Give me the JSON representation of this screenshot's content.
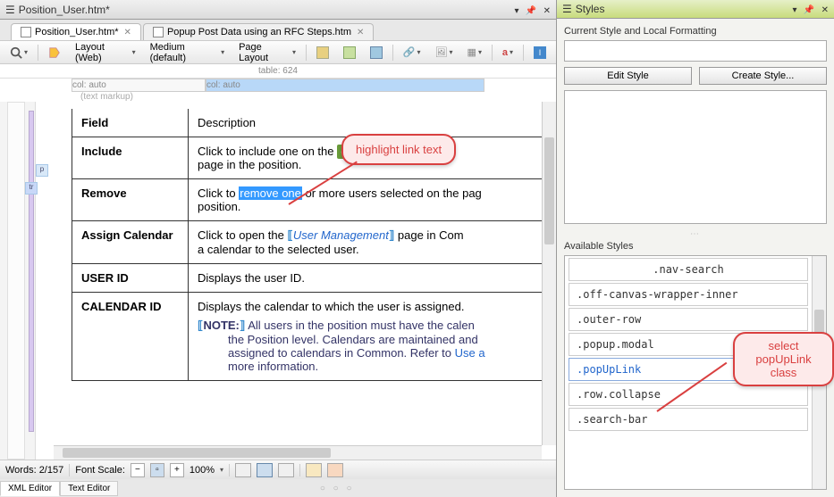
{
  "editor": {
    "title": "Position_User.htm*",
    "tabs": [
      {
        "label": "Position_User.htm*",
        "active": true
      },
      {
        "label": "Popup Post Data using an RFC Steps.htm",
        "active": false
      }
    ],
    "toolbar": {
      "layout_label": "Layout (Web)",
      "medium_label": "Medium (default)",
      "page_layout_label": "Page Layout"
    },
    "ruler": {
      "table_label": "table: 624",
      "col1": "col: auto",
      "col2": "col: auto",
      "markup": "(text markup)"
    },
    "table": {
      "row0": {
        "field": "Field",
        "desc": "Description"
      },
      "row_include": {
        "field": "Include",
        "desc_before": "Click to include one                                        on the ",
        "dsp": "dsp",
        "desc_after": " page in the position."
      },
      "row_remove": {
        "field": "Remove",
        "desc_before": "Click to ",
        "highlight": "remove one",
        "desc_after": " or more users selected on the pag",
        "desc_line2": "position."
      },
      "row_assign": {
        "field": "Assign Calendar",
        "desc_before": "Click to open the ",
        "link": "User Management",
        "desc_after": " page in Com",
        "desc_line2": "a calendar to the selected user."
      },
      "row_userid": {
        "field": "USER ID",
        "desc": "Displays the user ID."
      },
      "row_calid": {
        "field": "CALENDAR ID",
        "desc_l1": "Displays the calendar to which the user is assigned.",
        "note_label": "NOTE:",
        "note_body": " All users in the position must have the calen",
        "note_l2": "the Position level. Calendars are maintained and ",
        "note_l3_before": "assigned to calendars in Common. Refer to ",
        "note_l3_link": "Use a",
        "note_l4": "more information."
      }
    },
    "status": {
      "words": "Words: 2/157",
      "font_scale_label": "Font Scale:",
      "zoom": "100%"
    },
    "bottom_tabs": {
      "xml": "XML Editor",
      "text": "Text Editor"
    }
  },
  "styles": {
    "title": "Styles",
    "current_label": "Current Style and Local Formatting",
    "edit_btn": "Edit Style",
    "create_btn": "Create Style...",
    "available_label": "Available Styles",
    "items": [
      ".nav-search",
      ".off-canvas-wrapper-inner",
      ".outer-row",
      ".popup.modal",
      ".popUpLink",
      ".row.collapse",
      ".search-bar"
    ]
  },
  "callouts": {
    "c1": "highlight link text",
    "c2": "select popUpLink class"
  }
}
